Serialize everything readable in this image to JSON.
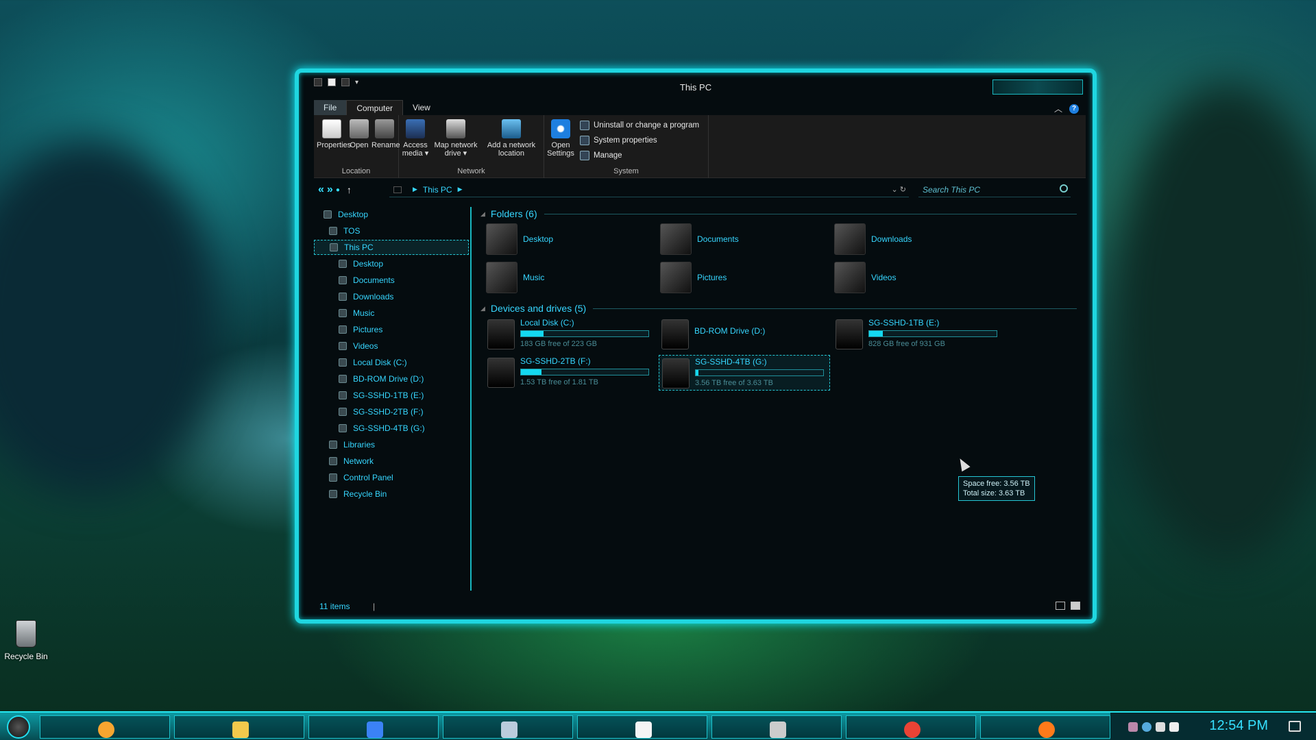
{
  "desktop": {
    "icons": [
      {
        "label": "Recycle Bin",
        "icon": "recycle-bin-icon"
      }
    ]
  },
  "window": {
    "title": "This PC",
    "ribbon_tabs": [
      "File",
      "Computer",
      "View"
    ],
    "ribbon": {
      "location": {
        "label": "Location",
        "buttons": [
          {
            "label": "Properties",
            "icon": "properties-icon"
          },
          {
            "label": "Open",
            "icon": "open-icon"
          },
          {
            "label": "Rename",
            "icon": "rename-icon"
          }
        ]
      },
      "network": {
        "label": "Network",
        "buttons": [
          {
            "line1": "Access",
            "line2": "media ▾",
            "icon": "access-media-icon"
          },
          {
            "line1": "Map network",
            "line2": "drive ▾",
            "icon": "map-network-drive-icon"
          },
          {
            "line1": "Add a network",
            "line2": "location",
            "icon": "add-network-location-icon"
          }
        ]
      },
      "system": {
        "label": "System",
        "open_settings": {
          "line1": "Open",
          "line2": "Settings",
          "icon": "gear-icon"
        },
        "items": [
          {
            "label": "Uninstall or change a program",
            "icon": "uninstall-icon"
          },
          {
            "label": "System properties",
            "icon": "system-properties-icon"
          },
          {
            "label": "Manage",
            "icon": "manage-icon"
          }
        ]
      }
    },
    "address": {
      "path": "This PC",
      "search_placeholder": "Search This PC"
    },
    "nav_pane": [
      {
        "label": "Desktop",
        "indent": 0,
        "icon": "desktop-icon"
      },
      {
        "label": "TOS",
        "indent": 1,
        "icon": "user-icon"
      },
      {
        "label": "This PC",
        "indent": 1,
        "icon": "computer-icon",
        "selected": true
      },
      {
        "label": "Desktop",
        "indent": 2,
        "icon": "desktop-icon"
      },
      {
        "label": "Documents",
        "indent": 2,
        "icon": "documents-icon"
      },
      {
        "label": "Downloads",
        "indent": 2,
        "icon": "downloads-icon"
      },
      {
        "label": "Music",
        "indent": 2,
        "icon": "music-icon"
      },
      {
        "label": "Pictures",
        "indent": 2,
        "icon": "pictures-icon"
      },
      {
        "label": "Videos",
        "indent": 2,
        "icon": "videos-icon"
      },
      {
        "label": "Local Disk (C:)",
        "indent": 2,
        "icon": "drive-icon"
      },
      {
        "label": "BD-ROM Drive (D:)",
        "indent": 2,
        "icon": "optical-drive-icon"
      },
      {
        "label": "SG-SSHD-1TB (E:)",
        "indent": 2,
        "icon": "drive-icon"
      },
      {
        "label": "SG-SSHD-2TB (F:)",
        "indent": 2,
        "icon": "drive-icon"
      },
      {
        "label": "SG-SSHD-4TB (G:)",
        "indent": 2,
        "icon": "drive-icon"
      },
      {
        "label": "Libraries",
        "indent": 1,
        "icon": "libraries-icon"
      },
      {
        "label": "Network",
        "indent": 1,
        "icon": "network-icon"
      },
      {
        "label": "Control Panel",
        "indent": 1,
        "icon": "control-panel-icon"
      },
      {
        "label": "Recycle Bin",
        "indent": 1,
        "icon": "recycle-bin-icon"
      }
    ],
    "folders": {
      "title": "Folders (6)",
      "items": [
        {
          "label": "Desktop",
          "icon": "desktop-folder-icon"
        },
        {
          "label": "Documents",
          "icon": "documents-folder-icon"
        },
        {
          "label": "Downloads",
          "icon": "downloads-folder-icon"
        },
        {
          "label": "Music",
          "icon": "music-folder-icon"
        },
        {
          "label": "Pictures",
          "icon": "pictures-folder-icon"
        },
        {
          "label": "Videos",
          "icon": "videos-folder-icon"
        }
      ]
    },
    "drives": {
      "title": "Devices and drives (5)",
      "items": [
        {
          "label": "Local Disk (C:)",
          "free": "183 GB free of 223 GB",
          "used_fraction": 0.18,
          "icon": "hard-drive-icon"
        },
        {
          "label": "BD-ROM Drive (D:)",
          "free": "",
          "used_fraction": null,
          "icon": "bd-rom-icon"
        },
        {
          "label": "SG-SSHD-1TB (E:)",
          "free": "828 GB free of 931 GB",
          "used_fraction": 0.11,
          "icon": "hard-drive-icon"
        },
        {
          "label": "SG-SSHD-2TB (F:)",
          "free": "1.53 TB free of 1.81 TB",
          "used_fraction": 0.16,
          "icon": "hard-drive-icon"
        },
        {
          "label": "SG-SSHD-4TB (G:)",
          "free": "3.56 TB free of 3.63 TB",
          "used_fraction": 0.02,
          "icon": "hard-drive-icon",
          "selected": true
        }
      ]
    },
    "tooltip": {
      "line1": "Space free: 3.56 TB",
      "line2": "Total size: 3.63 TB"
    },
    "status": {
      "items": "11 items"
    }
  },
  "taskbar": {
    "apps": [
      "weather-icon",
      "file-explorer-icon",
      "app-icon",
      "recycle-icon",
      "calendar-icon",
      "edit-icon",
      "chrome-icon",
      "firefox-icon"
    ],
    "clock": "12:54 PM"
  },
  "colors": {
    "accent": "#1fd6e0",
    "text_accent": "#36d6ff",
    "window_bg": "#050c0f"
  }
}
